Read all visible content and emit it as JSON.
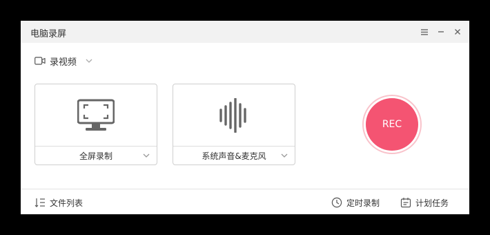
{
  "window": {
    "title": "电脑录屏",
    "buttons": [
      "menu-icon",
      "minimize-icon",
      "close-icon"
    ]
  },
  "mode": {
    "label": "录视频",
    "icon": "video-camera-icon"
  },
  "cards": [
    {
      "label": "全屏录制",
      "icon": "monitor-fullscreen-icon"
    },
    {
      "label": "系统声音&麦克风",
      "icon": "audio-waveform-icon"
    }
  ],
  "record": {
    "label": "REC",
    "color": "#f45472",
    "ring_color": "#f9c3cb"
  },
  "footer": {
    "file_list": "文件列表",
    "scheduled": "定时录制",
    "tasks": "计划任务"
  }
}
